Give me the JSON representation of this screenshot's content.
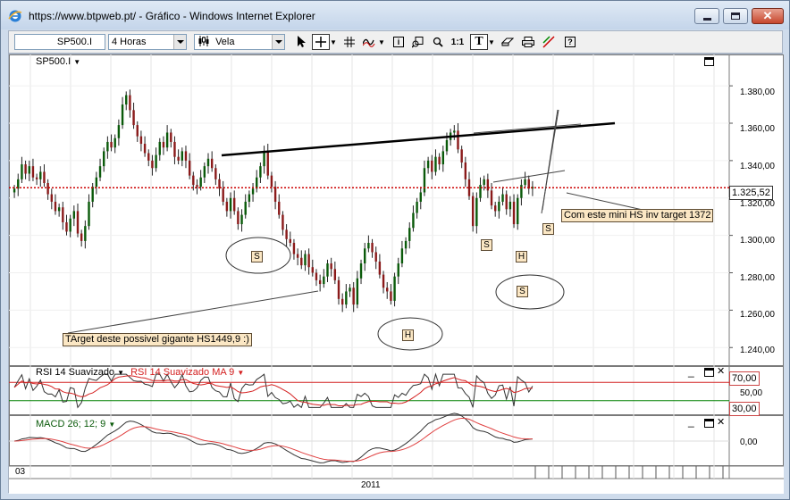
{
  "window": {
    "title": "https://www.btpweb.pt/ - Gráfico - Windows Internet Explorer"
  },
  "toolbar": {
    "symbol": "SP500.I",
    "period": "4 Horas",
    "chart_style": "Vela",
    "tools": [
      "cursor-icon",
      "crosshair-icon",
      "grid-icon",
      "indicators-icon",
      "info-icon",
      "zoom-window-icon",
      "zoom-icon",
      "one-to-one-icon",
      "text-tool-icon",
      "eraser-icon",
      "print-icon",
      "draw-lines-icon",
      "help-icon"
    ],
    "one_to_one_label": "1:1",
    "text_tool_label": "T",
    "help_label": "?"
  },
  "price_panel": {
    "label": "SP500.I",
    "current_price": "1.325,52",
    "y_ticks": [
      "1.380,00",
      "1.360,00",
      "1.340,00",
      "1.320,00",
      "1.300,00",
      "1.280,00",
      "1.260,00",
      "1.240,00"
    ],
    "annotations": {
      "target_big": "TArget deste possivel gigante HS1449,9 :)",
      "target_mini": "Com este mini HS inv target 1372"
    },
    "pattern_labels": [
      "S",
      "H",
      "S",
      "S",
      "H",
      "S",
      "S"
    ]
  },
  "rsi_panel": {
    "label": "RSI 14 Suavizado",
    "ma_label": "RSI 14 Suavizado MA 9",
    "upper": "70,00",
    "mid": "50,00",
    "lower": "30,00"
  },
  "macd_panel": {
    "label": "MACD 26; 12; 9",
    "zero": "0,00"
  },
  "x_axis": {
    "left_label": "03",
    "year_label": "2011"
  },
  "colors": {
    "resistance": "#cc0000",
    "rsi_ma": "#d42020",
    "macd_signal": "#e04040",
    "oversold_line": "#008000",
    "callout_fill": "#fbe7c4",
    "bull": "#0a5a0a",
    "bear": "#8a1a1a"
  },
  "chart_data": {
    "type": "line",
    "title": "SP500.I",
    "period": "4 Horas",
    "ylim": [
      1232,
      1392
    ],
    "x_label": "2011",
    "series": [
      {
        "name": "SP500.I",
        "values": [
          1325,
          1330,
          1338,
          1333,
          1337,
          1331,
          1330,
          1334,
          1328,
          1322,
          1318,
          1313,
          1315,
          1307,
          1302,
          1309,
          1313,
          1301,
          1297,
          1305,
          1318,
          1326,
          1331,
          1337,
          1345,
          1350,
          1347,
          1352,
          1359,
          1370,
          1375,
          1367,
          1359,
          1353,
          1349,
          1344,
          1340,
          1336,
          1343,
          1350,
          1347,
          1355,
          1350,
          1342,
          1340,
          1345,
          1340,
          1332,
          1327,
          1326,
          1331,
          1337,
          1341,
          1336,
          1330,
          1325,
          1318,
          1313,
          1320,
          1313,
          1306,
          1311,
          1318,
          1322,
          1325,
          1331,
          1337,
          1345,
          1332,
          1326,
          1318,
          1311,
          1303,
          1298,
          1296,
          1290,
          1288,
          1284,
          1290,
          1283,
          1280,
          1276,
          1274,
          1278,
          1285,
          1282,
          1276,
          1266,
          1263,
          1270,
          1272,
          1263,
          1277,
          1285,
          1293,
          1296,
          1291,
          1286,
          1279,
          1272,
          1270,
          1265,
          1278,
          1285,
          1293,
          1297,
          1304,
          1312,
          1318,
          1323,
          1336,
          1340,
          1334,
          1342,
          1338,
          1345,
          1351,
          1355,
          1356,
          1346,
          1339,
          1330,
          1321,
          1305,
          1320,
          1327,
          1330,
          1324,
          1316,
          1313,
          1318,
          1322,
          1314,
          1318,
          1306,
          1320,
          1327,
          1330,
          1325,
          1326
        ]
      }
    ],
    "resistance_level": 1325.52,
    "pattern_annotations": [
      "TArget deste possivel gigante HS1449,9 :)",
      "Com este mini HS inv target 1372"
    ]
  }
}
